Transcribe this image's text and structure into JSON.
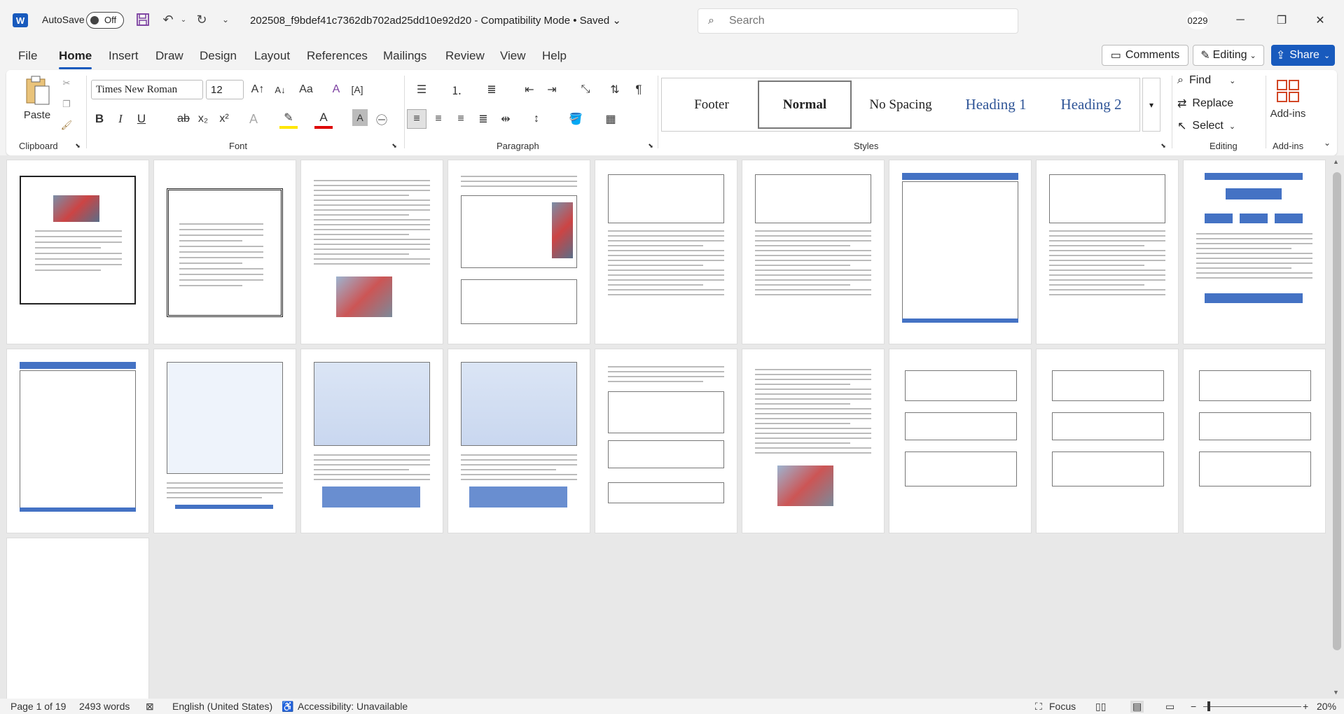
{
  "titlebar": {
    "logo": "W",
    "autosave_label": "AutoSave",
    "autosave_state": "Off",
    "doc_title": "202508_f9bdef41c7362db702ad25dd10e92d20  -  Compatibility Mode  •  Saved",
    "search_placeholder": "Search",
    "user": "0229"
  },
  "menu": {
    "tabs": [
      "File",
      "Home",
      "Insert",
      "Draw",
      "Design",
      "Layout",
      "References",
      "Mailings",
      "Review",
      "View",
      "Help"
    ],
    "active": "Home",
    "comments": "Comments",
    "editing": "Editing",
    "share": "Share"
  },
  "ribbon": {
    "clipboard": {
      "paste": "Paste",
      "label": "Clipboard"
    },
    "font": {
      "name": "Times New Roman",
      "size": "12",
      "label": "Font"
    },
    "paragraph": {
      "label": "Paragraph"
    },
    "styles": {
      "label": "Styles",
      "items": [
        "Footer",
        "Normal",
        "No Spacing",
        "Heading 1",
        "Heading 2"
      ],
      "selected": "Normal"
    },
    "editing": {
      "label": "Editing",
      "find": "Find",
      "replace": "Replace",
      "select": "Select"
    },
    "addins": {
      "label": "Add-ins",
      "button": "Add-ins"
    }
  },
  "document": {
    "page_count": 19,
    "thumbnails_visible": 19
  },
  "statusbar": {
    "page": "Page 1 of 19",
    "words": "2493 words",
    "language": "English (United States)",
    "accessibility": "Accessibility: Unavailable",
    "focus": "Focus",
    "zoom": "20%"
  },
  "colors": {
    "accent": "#185abd",
    "heading": "#2f5597",
    "table_fill": "#4472c4"
  }
}
